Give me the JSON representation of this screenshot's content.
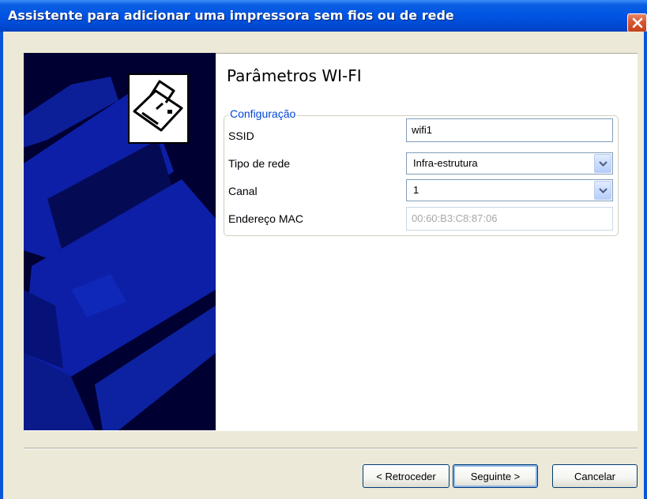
{
  "window": {
    "title": "Assistente para adicionar uma impressora sem fios ou de rede"
  },
  "page": {
    "heading": "Parâmetros WI-FI"
  },
  "group": {
    "label": "Configuração",
    "fields": {
      "ssid": {
        "label": "SSID",
        "value": "wifi1"
      },
      "network_type": {
        "label": "Tipo de rede",
        "value": "Infra-estrutura"
      },
      "channel": {
        "label": "Canal",
        "value": "1"
      },
      "mac": {
        "label": "Endereço MAC",
        "value": "00:60:B3:C8:87:06"
      }
    }
  },
  "buttons": {
    "back": "< Retroceder",
    "next": "Seguinte >",
    "cancel": "Cancelar"
  },
  "colors": {
    "title_bar": "#0054e3",
    "side_panel": "#000033",
    "group_label": "#0046d5"
  },
  "icons": [
    "printer-icon",
    "close-icon",
    "chevron-down-icon"
  ]
}
